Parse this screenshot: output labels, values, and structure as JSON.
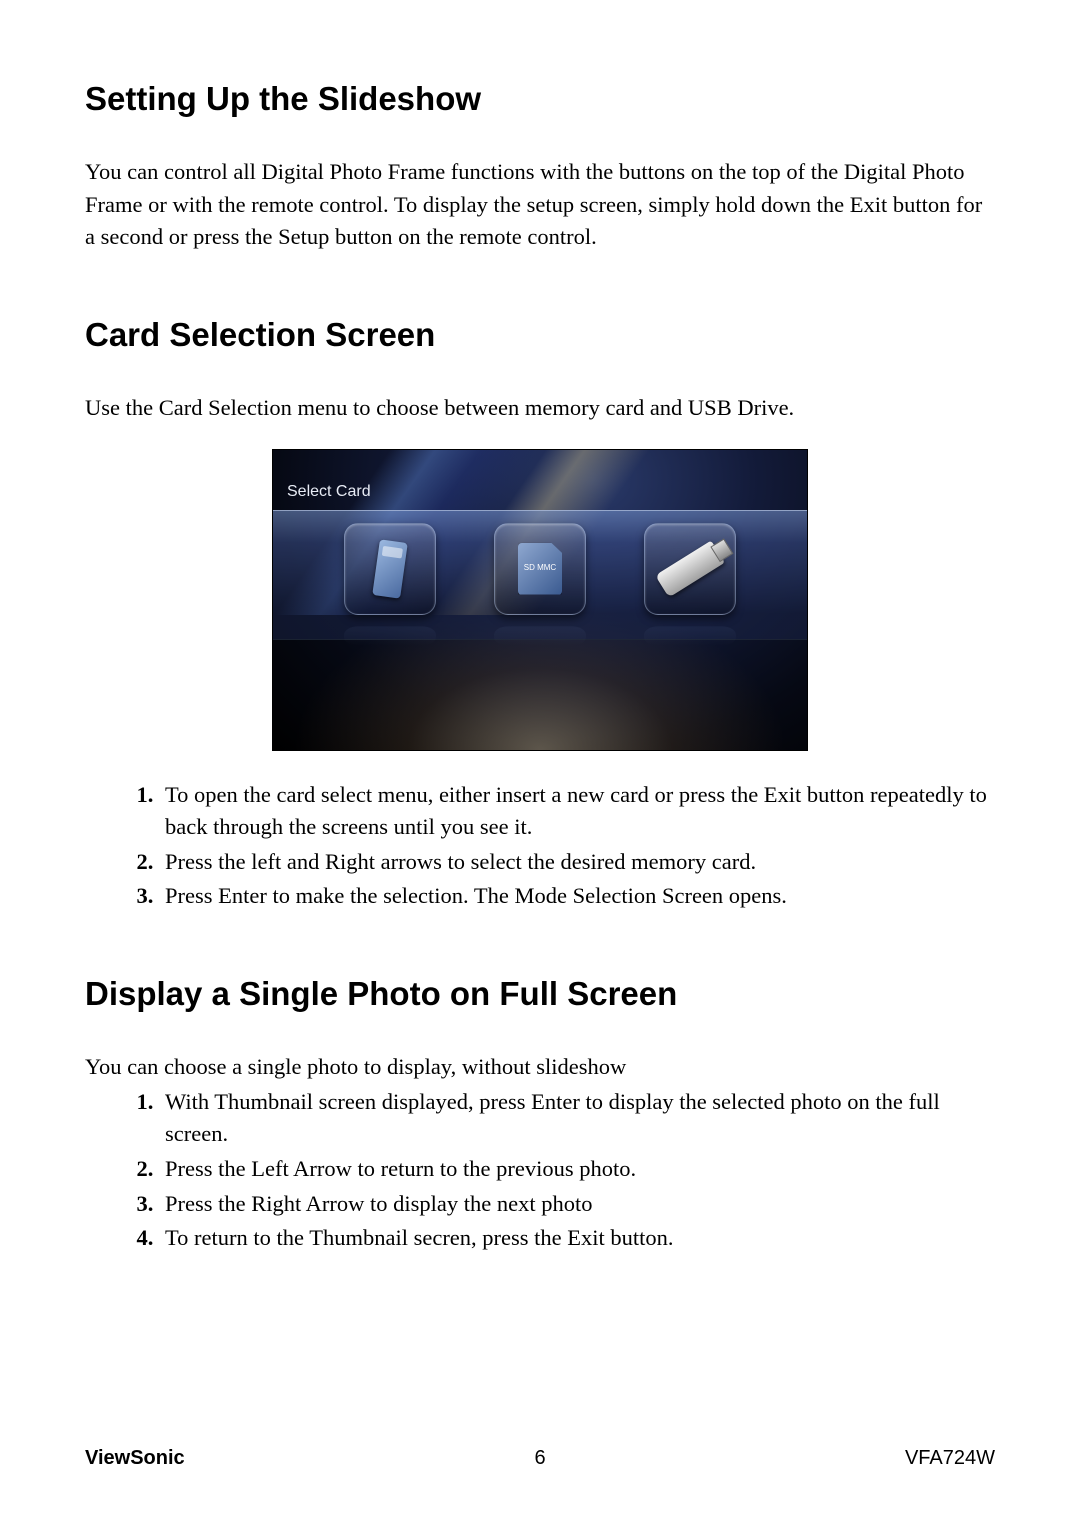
{
  "sections": {
    "slideshow": {
      "heading": "Setting Up the Slideshow",
      "para": "You can control all Digital Photo Frame functions with the buttons on the top of the Digital Photo Frame or with the remote control. To display the setup screen, simply hold down the Exit button for a second or press the Setup button on the remote control."
    },
    "card_selection": {
      "heading": "Card Selection Screen",
      "para": "Use the Card Selection menu to choose between memory card and USB Drive.",
      "screenshot_label": "Select Card",
      "sd_label": "SD\nMMC",
      "steps": [
        "To open the card select menu, either insert a new card or press the Exit button repeatedly to back through the screens until you see it.",
        "Press the left and Right arrows to select the desired memory card.",
        "Press Enter to make the selection. The Mode Selection Screen opens."
      ]
    },
    "single_photo": {
      "heading": "Display a Single Photo on Full Screen",
      "para": "You can choose a single photo to display, without slideshow",
      "steps": [
        "With Thumbnail screen displayed, press Enter to display the selected photo on the full screen.",
        "Press the Left Arrow to return to the previous photo.",
        "Press the Right Arrow to display the next photo",
        "To return to the Thumbnail secren, press the Exit button."
      ]
    }
  },
  "footer": {
    "brand": "ViewSonic",
    "page": "6",
    "model": "VFA724W"
  }
}
